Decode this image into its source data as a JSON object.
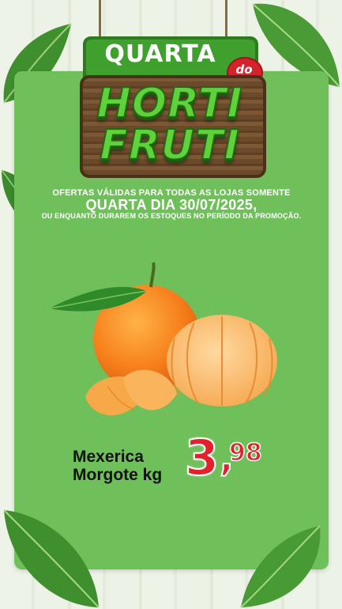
{
  "header": {
    "title_top": "QUARTA",
    "title_do": "do",
    "title_main_1": "HORTI",
    "title_main_2": "FRUTI"
  },
  "offer": {
    "line1": "OFERTAS VÁLIDAS PARA TODAS AS LOJAS SOMENTE",
    "line2": "QUARTA DIA 30/07/2025,",
    "line3": "OU ENQUANTO DURAREM OS ESTOQUES NO PERÍODO DA PROMOÇÃO."
  },
  "product": {
    "name_line1": "Mexerica",
    "name_line2": "Morgote kg",
    "price_int": "3",
    "price_comma": ",",
    "price_dec": "98",
    "image": "tangerine-illustration"
  },
  "colors": {
    "panel": "#6fc05a",
    "price": "#e4202a",
    "banner": "#3fa02d"
  }
}
